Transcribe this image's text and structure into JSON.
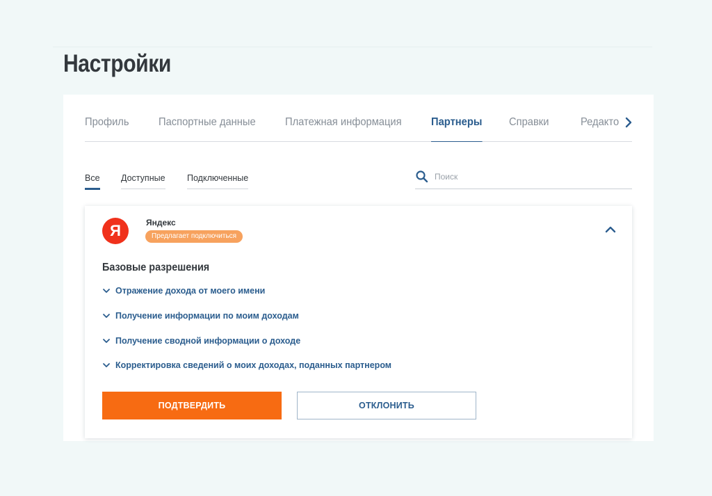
{
  "page": {
    "title": "Настройки"
  },
  "tabs": [
    {
      "label": "Профиль",
      "active": false
    },
    {
      "label": "Паспортные данные",
      "active": false
    },
    {
      "label": "Платежная информация",
      "active": false
    },
    {
      "label": "Партнеры",
      "active": true
    },
    {
      "label": "Справки",
      "active": false
    },
    {
      "label": "Редакто",
      "active": false
    }
  ],
  "tabs_next_icon": "chevron-right-icon",
  "filters": [
    {
      "label": "Все",
      "active": true
    },
    {
      "label": "Доступные",
      "active": false
    },
    {
      "label": "Подключенные",
      "active": false
    }
  ],
  "search": {
    "placeholder": "Поиск",
    "value": "",
    "icon": "search-icon"
  },
  "partner": {
    "logo_letter": "Я",
    "name": "Яндекс",
    "status": "Предлагает подключиться",
    "collapse_icon": "chevron-up-icon",
    "section_title": "Базовые разрешения",
    "permissions": [
      "Отражение дохода от моего имени",
      "Получение информации по моим доходам",
      "Получение сводной информации о доходе",
      "Корректировка сведений о моих доходах, поданных партнером"
    ],
    "confirm_label": "ПОДТВЕРДИТЬ",
    "decline_label": "ОТКЛОНИТЬ"
  },
  "colors": {
    "accent": "#2b5d8e",
    "confirm": "#f76b12",
    "badge": "#f7a25e",
    "logo": "#f0311b",
    "background": "#f1f8f8"
  }
}
